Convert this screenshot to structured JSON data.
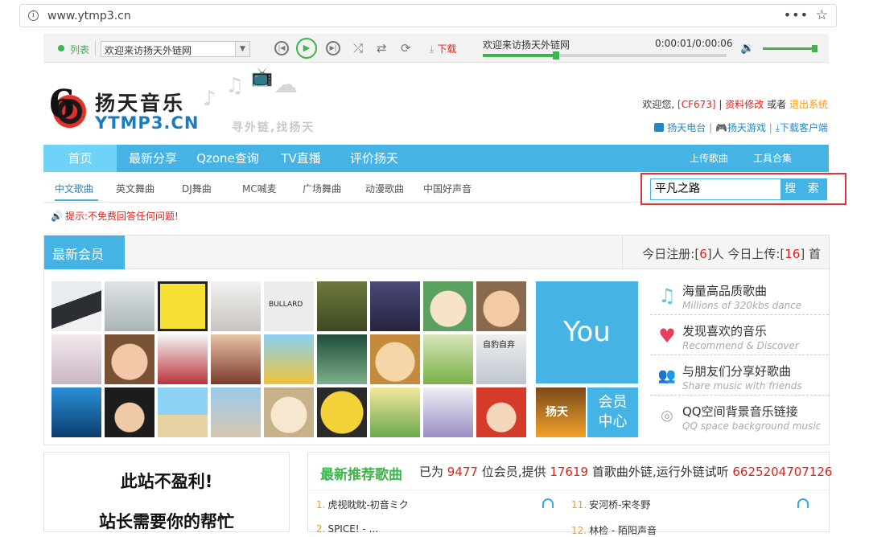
{
  "browser": {
    "url": "www.ytmp3.cn",
    "info_icon": "i",
    "menu_icon": "•••",
    "star_icon": "☆"
  },
  "player": {
    "list_label": "列表",
    "selected_list": "欢迎来访扬天外链网",
    "download_label": "下载",
    "now_playing": "欢迎来访扬天外链网",
    "time": "0:00:01/0:00:06",
    "progress": 0.3,
    "volume": 1.0,
    "accent": "#3cb54a"
  },
  "header": {
    "logo_cn": "扬天音乐",
    "logo_en": "YTMP3.CN",
    "slogan": "寻外链,找扬天",
    "welcome": "欢迎您,",
    "username": "[CF673]",
    "sep1": "|",
    "edit_profile": "资料修改",
    "or": "或者",
    "logout": "退出系统",
    "link1": "扬天电台",
    "link2": "扬天游戏",
    "link3": "下载客户端",
    "link_sep": "|"
  },
  "nav": {
    "items": [
      "首页",
      "最新分享",
      "Qzone查询",
      "TV直播",
      "评价扬天"
    ],
    "right": [
      "上传歌曲",
      "工具合集"
    ],
    "color": "#45b3e4"
  },
  "subnav": {
    "items": [
      "中文歌曲",
      "英文舞曲",
      "DJ舞曲",
      "MC喊麦",
      "广场舞曲",
      "动漫歌曲",
      "中国好声音"
    ]
  },
  "search": {
    "value": "平凡之路",
    "button": "搜 索"
  },
  "tip": {
    "icon": "🔊",
    "text": "提示:不免费回答任何问题!"
  },
  "members": {
    "title": "最新会员",
    "stat_prefix": "今日注册:[",
    "reg_count": "6",
    "stat_mid": "]人 今日上传:[",
    "upload_count": "16",
    "stat_suffix": "] 首",
    "you": "You",
    "member_center": [
      "会员",
      "中心"
    ],
    "avatar_texts": [
      "BULLARD",
      "自豹自弃",
      "扬天"
    ],
    "features": [
      {
        "icon": "music-note-icon",
        "glyph": "♫",
        "color": "#5fc4e8",
        "title": "海量高品质歌曲",
        "sub": "Millions of 320kbs dance"
      },
      {
        "icon": "heart-icon",
        "glyph": "♥",
        "color": "#e83e5a",
        "title": "发现喜欢的音乐",
        "sub": "Recommend & Discover"
      },
      {
        "icon": "friends-icon",
        "glyph": "👥",
        "color": "#3cb54a",
        "title": "与朋友们分享好歌曲",
        "sub": "Share music with friends"
      },
      {
        "icon": "location-pin-icon",
        "glyph": "⌾",
        "color": "#888888",
        "title": "QQ空间背景音乐链接",
        "sub": "QQ space background music"
      }
    ]
  },
  "donate": {
    "line1": "此站不盈利!",
    "line2": "站长需要你的帮忙"
  },
  "songs": {
    "title": "最新推荐歌曲",
    "s1": "已为",
    "members_count": "9477",
    "s2": "位会员,提供",
    "songs_count": "17619",
    "s3": "首歌曲外链,运行外链试听",
    "plays_count": "6625204707126",
    "rows": [
      {
        "num": "1.",
        "name": "虎视眈眈-初音ミク"
      },
      {
        "num": "11.",
        "name": "安河桥-宋冬野"
      },
      {
        "num": "2.",
        "name": "SPICE! - ..."
      },
      {
        "num": "12.",
        "name": "林检 - 陌阳声音"
      }
    ]
  }
}
